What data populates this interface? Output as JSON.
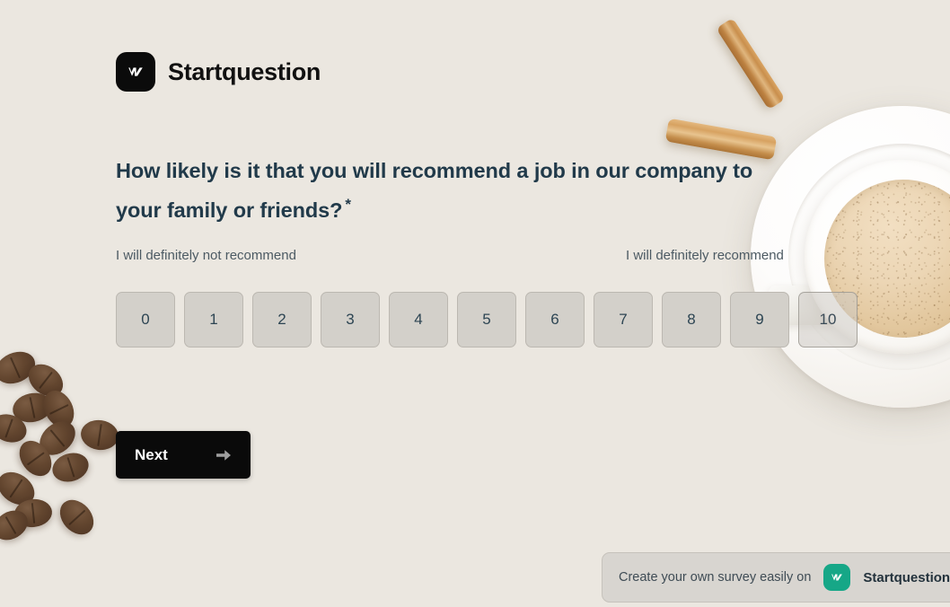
{
  "brand": {
    "name": "Startquestion",
    "mark_icon": "w-logo-icon",
    "mark_bg": "#0b0b0b"
  },
  "question": {
    "text": "How likely is it that you will recommend a job in our company to your family or friends?",
    "required_marker": "*",
    "color": "#213a4a"
  },
  "scale": {
    "low_label": "I will definitely not recommend",
    "high_label": "I will definitely recommend",
    "options": [
      "0",
      "1",
      "2",
      "3",
      "4",
      "5",
      "6",
      "7",
      "8",
      "9",
      "10"
    ],
    "button_bg": "#d3d0ca",
    "button_text_color": "#2d4553"
  },
  "actions": {
    "next_label": "Next",
    "next_icon": "arrow-right-icon",
    "next_bg": "#0a0a0a"
  },
  "promo": {
    "text": "Create your own survey easily on",
    "brand": "Startquestion",
    "mark_icon": "w-logo-icon",
    "mark_bg": "#16a787"
  },
  "theme": {
    "page_background": "#ebe7e0"
  }
}
